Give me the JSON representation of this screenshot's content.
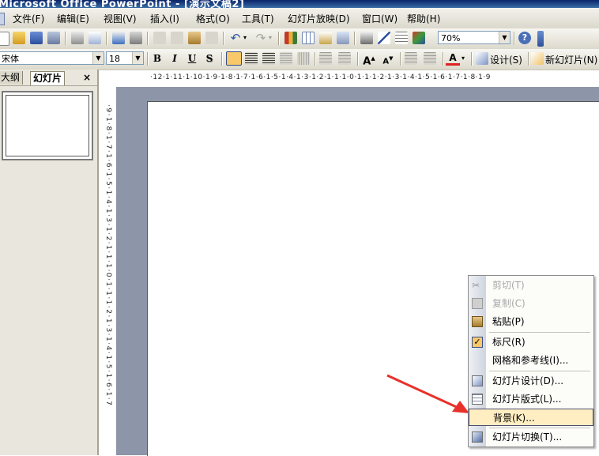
{
  "window": {
    "title": "Microsoft Office PowerPoint - [演示文稿2]"
  },
  "menu": [
    "文件(F)",
    "编辑(E)",
    "视图(V)",
    "插入(I)",
    "格式(O)",
    "工具(T)",
    "幻灯片放映(D)",
    "窗口(W)",
    "帮助(H)"
  ],
  "toolbar": {
    "zoom_value": "70%",
    "help_icon": "?"
  },
  "format_toolbar": {
    "font_name": "宋体",
    "font_size": "18",
    "bold": "B",
    "italic": "I",
    "underline": "U",
    "shadow": "S",
    "design_label": "设计(S)",
    "new_slide_label": "新幻灯片(N)"
  },
  "pane": {
    "tab_outline": "大纲",
    "tab_slides": "幻灯片",
    "close": "×"
  },
  "ruler": {
    "h_text": "·12·1·11·1·10·1·9·1·8·1·7·1·6·1·5·1·4·1·3·1·2·1·1·1·0·1·1·1·2·1·3·1·4·1·5·1·6·1·7·1·8·1·9",
    "v_text": "·9·1·8·1·7·1·6·1·5·1·4·1·3·1·2·1·1·1·0·1·1·1·2·1·3·1·4·1·5·1·6·1·7"
  },
  "context_menu": {
    "items": [
      {
        "label": "剪切(T)",
        "enabled": false,
        "icon": "scissors-icon"
      },
      {
        "label": "复制(C)",
        "enabled": false,
        "icon": "copy-icon"
      },
      {
        "label": "粘贴(P)",
        "enabled": true,
        "icon": "paste-icon"
      },
      {
        "label": "标尺(R)",
        "enabled": true,
        "icon": "check-icon",
        "checked": true
      },
      {
        "label": "网格和参考线(I)...",
        "enabled": true,
        "icon": ""
      },
      {
        "label": "幻灯片设计(D)...",
        "enabled": true,
        "icon": "slide-design-icon"
      },
      {
        "label": "幻灯片版式(L)...",
        "enabled": true,
        "icon": "slide-layout-icon"
      },
      {
        "label": "背景(K)...",
        "enabled": true,
        "icon": "",
        "highlighted": true
      },
      {
        "label": "幻灯片切换(T)...",
        "enabled": true,
        "icon": "slide-transition-icon"
      }
    ]
  },
  "annotation": {
    "arrow_color": "#e8312b"
  }
}
